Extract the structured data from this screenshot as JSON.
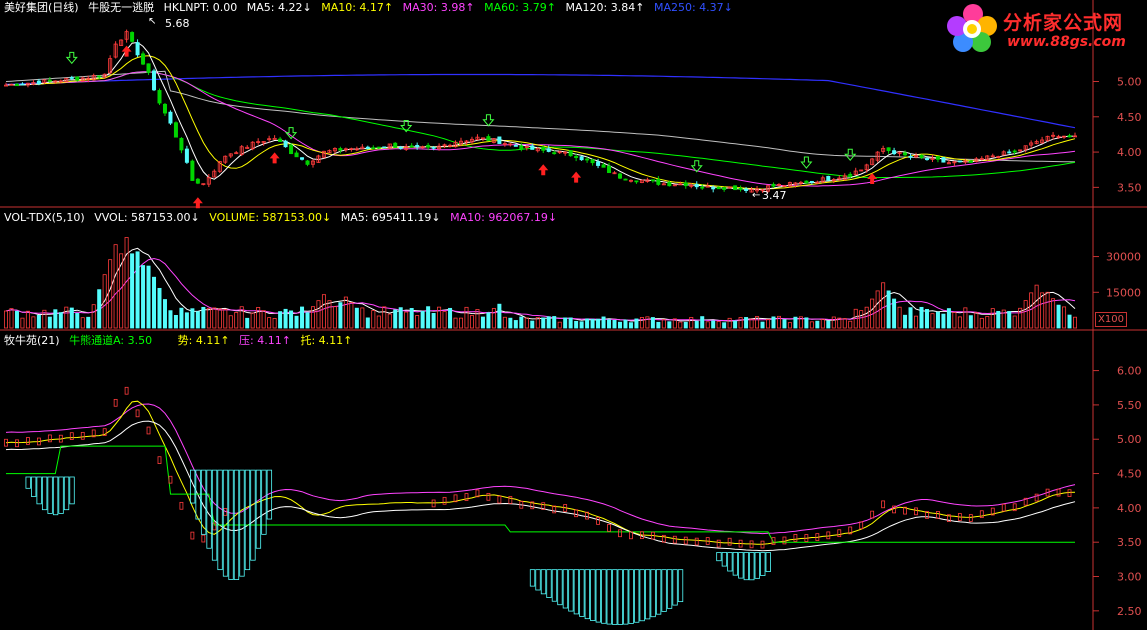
{
  "colors": {
    "background": "#000000",
    "up": "#ff3c3c",
    "down": "#54fcfc",
    "green": "#00d400",
    "ma5": "#ffffff",
    "ma10": "#ffff00",
    "ma30": "#ff44ff",
    "ma60": "#00ff00",
    "ma120": "#c0c0c0",
    "ma250": "#3030ff",
    "axis": "#c83232"
  },
  "price_panel": {
    "title": "美好集团(日线)",
    "indicator_name": "牛股无一逃脱",
    "hklnpt": "HKLNPT: 0.00",
    "ma5": "MA5: 4.22↓",
    "ma10": "MA10: 4.17↑",
    "ma30": "MA30: 3.98↑",
    "ma60": "MA60: 3.79↑",
    "ma120": "MA120: 3.84↑",
    "ma250": "MA250: 4.37↓",
    "high_label": "5.68",
    "low_label": "3.47",
    "axis_ticks": [
      "5.00",
      "4.50",
      "4.00",
      "3.50"
    ]
  },
  "volume_panel": {
    "name": "VOL-TDX(5,10)",
    "vvol": "VVOL: 587153.00↓",
    "volume": "VOLUME: 587153.00↓",
    "ma5": "MA5: 695411.19↓",
    "ma10": "MA10: 962067.19↓",
    "axis_ticks": [
      "30000",
      "15000"
    ],
    "unit": "X100"
  },
  "indicator_panel": {
    "name": "牧牛苑(21)",
    "channel": "牛熊通道A: 3.50",
    "trend": "势: 4.11↑",
    "pressure": "压: 4.11↑",
    "support": "托: 4.11↑",
    "axis_ticks": [
      "6.00",
      "5.50",
      "5.00",
      "4.50",
      "4.00",
      "3.50",
      "3.00",
      "2.50"
    ]
  },
  "logo": {
    "title": "分析家公式网",
    "url": "www.88gs.com"
  },
  "chart_data": {
    "type": "candlestick",
    "price_ylim": [
      3.25,
      5.9
    ],
    "price_ticks": [
      5.0,
      4.5,
      4.0,
      3.5
    ],
    "volume_ticks": [
      30000,
      15000
    ],
    "indicator_ylim": [
      2.25,
      6.3
    ],
    "indicator_ticks": [
      6.0,
      5.5,
      5.0,
      4.5,
      4.0,
      3.5,
      3.0,
      2.5
    ],
    "close_path": [
      [
        0,
        4.95
      ],
      [
        14,
        5.05
      ],
      [
        18,
        5.1
      ],
      [
        20,
        5.55
      ],
      [
        22,
        5.68
      ],
      [
        24,
        5.4
      ],
      [
        26,
        5.1
      ],
      [
        28,
        4.7
      ],
      [
        30,
        4.4
      ],
      [
        32,
        4.05
      ],
      [
        34,
        3.6
      ],
      [
        36,
        3.55
      ],
      [
        38,
        3.75
      ],
      [
        40,
        3.95
      ],
      [
        43,
        4.05
      ],
      [
        46,
        4.15
      ],
      [
        49,
        4.2
      ],
      [
        52,
        4.0
      ],
      [
        55,
        3.85
      ],
      [
        58,
        4.0
      ],
      [
        62,
        4.05
      ],
      [
        66,
        4.05
      ],
      [
        70,
        4.1
      ],
      [
        74,
        4.05
      ],
      [
        78,
        4.05
      ],
      [
        82,
        4.15
      ],
      [
        86,
        4.2
      ],
      [
        90,
        4.15
      ],
      [
        95,
        4.05
      ],
      [
        100,
        4.0
      ],
      [
        104,
        3.95
      ],
      [
        108,
        3.8
      ],
      [
        112,
        3.65
      ],
      [
        116,
        3.6
      ],
      [
        120,
        3.55
      ],
      [
        124,
        3.55
      ],
      [
        128,
        3.5
      ],
      [
        132,
        3.5
      ],
      [
        136,
        3.47
      ],
      [
        140,
        3.52
      ],
      [
        144,
        3.55
      ],
      [
        148,
        3.6
      ],
      [
        152,
        3.65
      ],
      [
        156,
        3.75
      ],
      [
        160,
        4.05
      ],
      [
        164,
        3.95
      ],
      [
        168,
        3.9
      ],
      [
        172,
        3.85
      ],
      [
        176,
        3.85
      ],
      [
        180,
        3.95
      ],
      [
        184,
        4.0
      ],
      [
        188,
        4.15
      ],
      [
        192,
        4.25
      ],
      [
        195,
        4.2
      ]
    ],
    "volume_spikes": [
      [
        20,
        35000
      ],
      [
        22,
        38000
      ],
      [
        24,
        32000
      ],
      [
        26,
        26000
      ],
      [
        58,
        14000
      ],
      [
        62,
        13000
      ],
      [
        90,
        10000
      ],
      [
        160,
        19000
      ],
      [
        188,
        18000
      ],
      [
        190,
        15000
      ]
    ],
    "markers_up": [
      22,
      35,
      49,
      98,
      104,
      158
    ],
    "markers_down": [
      12,
      52,
      73,
      88,
      126,
      146,
      154
    ],
    "drops": [
      [
        2.95,
        4.55
      ],
      [
        3.9,
        4.45
      ],
      [
        2.3,
        3.1
      ],
      [
        2.95,
        3.35
      ]
    ]
  }
}
